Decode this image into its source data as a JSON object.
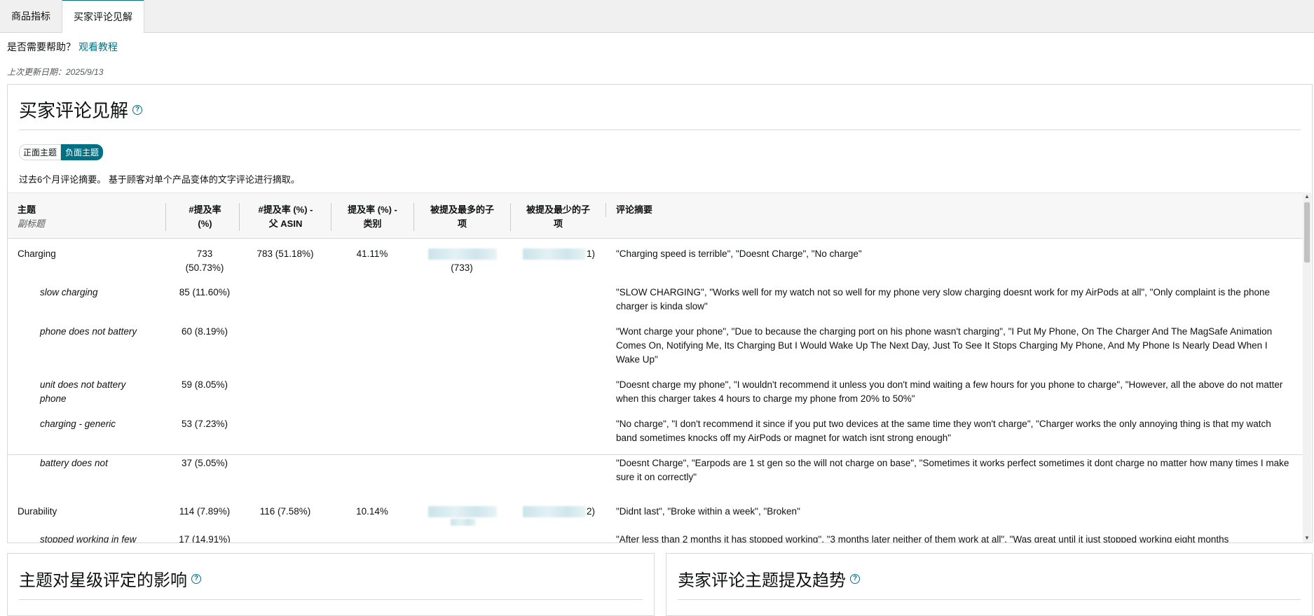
{
  "tabs": [
    {
      "label": "商品指标",
      "active": false
    },
    {
      "label": "买家评论见解",
      "active": true
    }
  ],
  "help": {
    "prefix": "是否需要帮助？",
    "link": "观看教程"
  },
  "updated": "上次更新日期：2025/9/13",
  "main": {
    "title": "买家评论见解",
    "toggles": {
      "positive": "正面主题",
      "negative": "负面主题"
    },
    "description": "过去6个月评论摘要。 基于顾客对单个产品变体的文字评论进行摘取。",
    "headers": {
      "theme": "主题",
      "subtitle": "副标题",
      "mention_rate_1": "#提及率",
      "mention_rate_2": "(%)",
      "parent_1": "#提及率 (%) -",
      "parent_2": "父 ASIN",
      "category_1": "提及率 (%) -",
      "category_2": "类别",
      "most_1": "被提及最多的子",
      "most_2": "项",
      "least_1": "被提及最少的子",
      "least_2": "项",
      "summary": "评论摘要"
    },
    "rows": [
      {
        "theme": "Charging",
        "mention_1": "733",
        "mention_2": "(50.73%)",
        "parent": "783 (51.18%)",
        "category": "41.11%",
        "most_suffix": "(733)",
        "least_suffix": "1)",
        "summary": "\"Charging speed is terrible\", \"Doesnt Charge\", \"No charge\""
      },
      {
        "sub": "slow charging",
        "mention": "85 (11.60%)",
        "summary": "\"SLOW CHARGING\", \"Works well for my watch not so well for my phone very slow charging doesnt work for my AirPods at all\", \"Only complaint is the phone charger is kinda slow\""
      },
      {
        "sub": "phone does not battery",
        "mention": "60 (8.19%)",
        "summary": "\"Wont charge your phone\", \"Due to because the charging port on his phone wasn't charging\", \"I Put My Phone, On The Charger And The MagSafe Animation Comes On, Notifying Me, Its Charging But I Would Wake Up The Next Day, Just To See It Stops Charging My Phone, And My Phone Is Nearly Dead When I Wake Up\""
      },
      {
        "sub_1": "unit does not battery",
        "sub_2": "phone",
        "mention": "59 (8.05%)",
        "summary": "\"Doesnt charge my phone\", \"I wouldn't recommend it unless you don't mind waiting a few hours for you phone to charge\", \"However, all the above do not matter when this charger takes 4 hours to charge my phone from 20% to 50%\""
      },
      {
        "sub": "charging - generic",
        "mention": "53 (7.23%)",
        "summary": "\"No charge\", \"I don't recommend it since if you put two devices at the same time they won't charge\", \"Charger works the only annoying thing is that my watch band sometimes knocks off my AirPods or magnet for watch isnt strong enough\""
      },
      {
        "sub": "battery does not",
        "mention": "37 (5.05%)",
        "summary": "\"Doesnt Charge\", \"Earpods are 1 st gen so the will not charge on base\", \"Sometimes it works perfect sometimes it dont charge no matter how many times I make sure it on correctly\""
      },
      {
        "theme": "Durability",
        "mention": "114 (7.89%)",
        "parent": "116 (7.58%)",
        "category": "10.14%",
        "least_suffix": "2)",
        "summary": "\"Didnt last\", \"Broke within a week\", \"Broken\""
      },
      {
        "sub": "stopped working in few",
        "mention": "17 (14.91%)",
        "summary": "\"After less than 2 months it has stopped working\", \"3 months later neither of them work at all\", \"Was great until it just stopped working eight months"
      }
    ]
  },
  "bottom_left": {
    "title": "主题对星级评定的影响"
  },
  "bottom_right": {
    "title": "卖家评论主题提及趋势"
  }
}
